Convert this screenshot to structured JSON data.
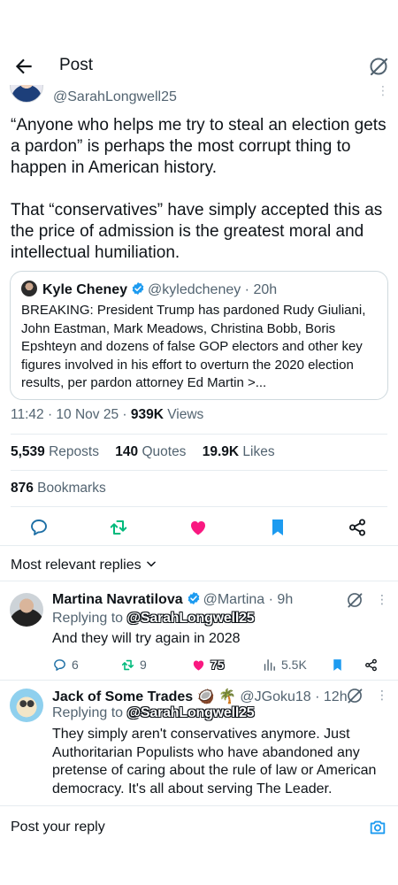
{
  "header": {
    "title": "Post"
  },
  "author": {
    "handle": "@SarahLongwell25"
  },
  "tweet": {
    "text": "“Anyone who helps me try to steal an election gets a pardon” is perhaps the most corrupt thing to happen in American history.\n\nThat “conservatives” have simply accepted this as the price of admission is the greatest moral and intellectual humiliation."
  },
  "quote": {
    "name": "Kyle Cheney",
    "meta": "@kyledcheney · 20h",
    "text": "BREAKING: President Trump has pardoned Rudy Giuliani, John Eastman, Mark Meadows, Christina Bobb, Boris Epshteyn and dozens of false GOP electors and other key figures involved in his effort to overturn the 2020 election results, per pardon attorney Ed Martin >..."
  },
  "meta": {
    "time": "11:42 · 10 Nov 25 · ",
    "views": "939K",
    "views_label": " Views"
  },
  "stats": {
    "reposts": "5,539",
    "reposts_label": " Reposts",
    "quotes": "140",
    "quotes_label": " Quotes",
    "likes": "19.9K",
    "likes_label": " Likes",
    "bookmarks": "876",
    "bookmarks_label": " Bookmarks"
  },
  "replies_header": {
    "label": "Most relevant replies"
  },
  "replies": [
    {
      "name": "Martina Navratilova",
      "meta": "@Martina · 9h",
      "replying_prefix": "Replying to ",
      "replying_to": "@SarahLongwell25",
      "text": "And they will try again in 2028",
      "comments": "6",
      "reposts": "9",
      "likes": "75",
      "views": "5.5K"
    },
    {
      "name": "Jack of Some Trades",
      "name_emoji": "🥥 🌴",
      "meta": "@JGoku18 · 12h",
      "replying_prefix": "Replying to ",
      "replying_to": "@SarahLongwell25",
      "text": "They simply aren't conservatives anymore. Just Authoritarian Populists who have abandoned any pretense of caring about the rule of law or American democracy. It's all about serving The Leader."
    }
  ],
  "compose": {
    "placeholder": "Post your reply"
  },
  "colors": {
    "blue": "#1d9bf0",
    "green": "#00ba7c",
    "pink": "#f91880",
    "gray": "#536471"
  },
  "icons": [
    "back-arrow-icon",
    "grok-icon",
    "verified-icon",
    "comment-icon",
    "repost-icon",
    "like-icon",
    "bookmark-icon",
    "share-icon",
    "chevron-down-icon",
    "views-icon",
    "camera-icon"
  ]
}
